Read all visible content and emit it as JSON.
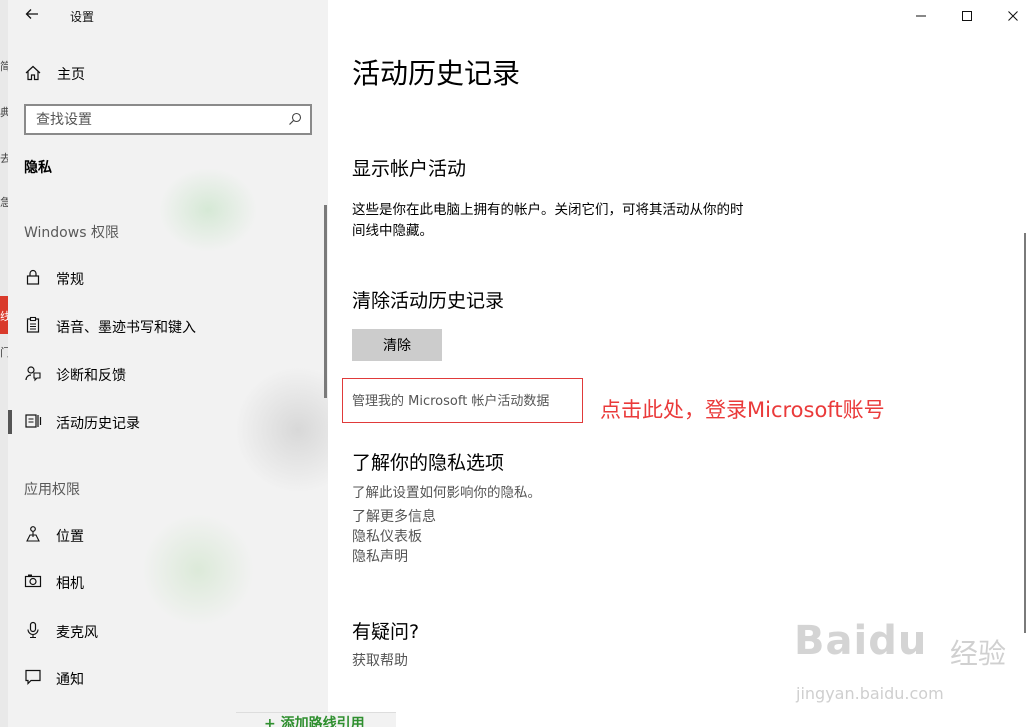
{
  "window": {
    "title": "设置",
    "back_icon": "arrow-left-icon",
    "minimize_icon": "minimize-icon",
    "maximize_icon": "maximize-icon",
    "close_icon": "close-icon"
  },
  "sidebar": {
    "home_label": "主页",
    "search_placeholder": "查找设置",
    "section_title": "隐私",
    "group_windows": "Windows 权限",
    "windows_items": [
      {
        "label": "常规",
        "icon": "lock-icon"
      },
      {
        "label": "语音、墨迹书写和键入",
        "icon": "clipboard-icon"
      },
      {
        "label": "诊断和反馈",
        "icon": "feedback-icon"
      },
      {
        "label": "活动历史记录",
        "icon": "timeline-icon",
        "selected": true
      }
    ],
    "group_apps": "应用权限",
    "app_items": [
      {
        "label": "位置",
        "icon": "location-icon"
      },
      {
        "label": "相机",
        "icon": "camera-icon"
      },
      {
        "label": "麦克风",
        "icon": "microphone-icon"
      },
      {
        "label": "通知",
        "icon": "notification-icon"
      }
    ]
  },
  "main": {
    "title": "活动历史记录",
    "show_accounts": {
      "heading": "显示帐户活动",
      "desc_line1": "这些是你在此电脑上拥有的帐户。关闭它们，可将其活动从你的时",
      "desc_line2": "间线中隐藏。"
    },
    "clear": {
      "heading": "清除活动历史记录",
      "button_label": "清除"
    },
    "manage_link": "管理我的 Microsoft 帐户活动数据",
    "annotation": "点击此处，登录Microsoft账号",
    "privacy": {
      "heading": "了解你的隐私选项",
      "desc": "了解此设置如何影响你的隐私。",
      "links": [
        "了解更多信息",
        "隐私仪表板",
        "隐私声明"
      ]
    },
    "help": {
      "heading": "有疑问?",
      "link": "获取帮助"
    }
  },
  "watermark": {
    "brand": "Baidu",
    "cn": "经验",
    "url": "jingyan.baidu.com"
  },
  "background_peek": {
    "text": "+ 添加路线引用",
    "left_glyphs": [
      "简",
      "典",
      "去",
      "急",
      "线",
      "门"
    ]
  },
  "colors": {
    "annotation": "#ea3a3a",
    "sidebar_bg": "#f2f2f2",
    "button_bg": "#cccccc"
  }
}
